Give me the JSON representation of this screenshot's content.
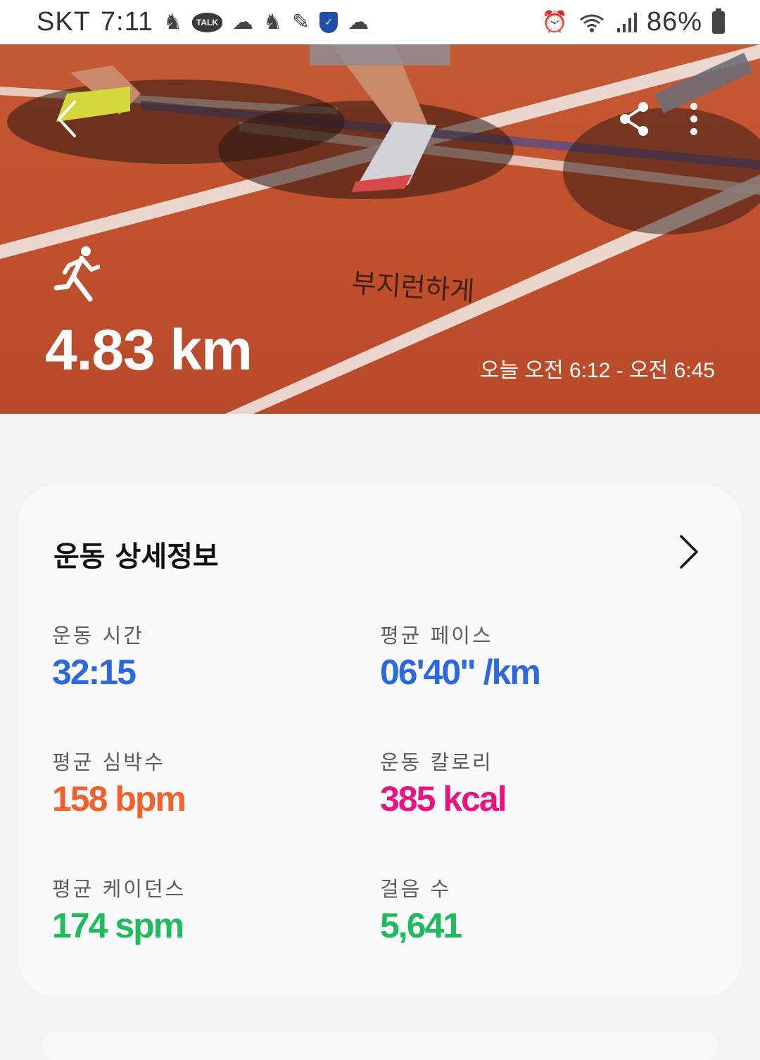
{
  "status_bar": {
    "carrier": "SKT",
    "time": "7:11",
    "battery": "86%"
  },
  "hero": {
    "distance": "4.83 km",
    "time_range": "오늘 오전 6:12 - 오전 6:45",
    "graffiti": "부지런하게"
  },
  "details": {
    "title": "운동 상세정보",
    "stats": [
      {
        "label": "운동 시간",
        "value": "32:15",
        "color": "#2c69e0"
      },
      {
        "label": "평균 페이스",
        "value": "06'40\" /km",
        "color": "#2c69e0"
      },
      {
        "label": "평균 심박수",
        "value": "158 bpm",
        "color": "#f2612d"
      },
      {
        "label": "운동 칼로리",
        "value": "385 kcal",
        "color": "#ea127f"
      },
      {
        "label": "평균 케이던스",
        "value": "174 spm",
        "color": "#1ebc5c"
      },
      {
        "label": "걸음 수",
        "value": "5,641",
        "color": "#1ebc5c"
      }
    ]
  }
}
